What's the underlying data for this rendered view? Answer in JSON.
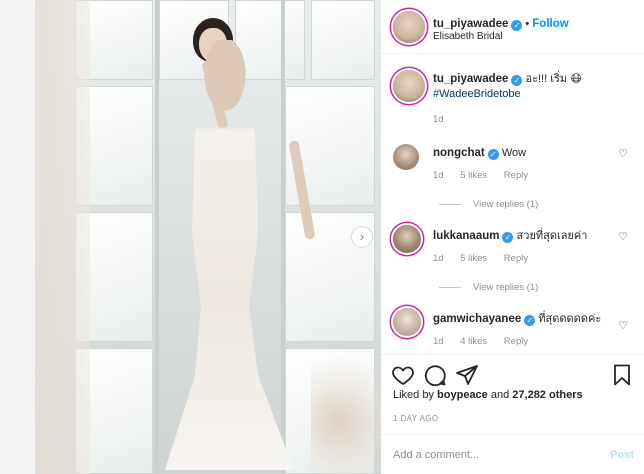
{
  "header": {
    "username": "tu_piyawadee",
    "follow_label": "Follow",
    "location": "Elisabeth Bridal",
    "dot": "•"
  },
  "caption": {
    "username": "tu_piyawadee",
    "text": "อะ!!! เริ่ม 😷",
    "hashtag": "#WadeeBridetobe",
    "age": "1d"
  },
  "comments": [
    {
      "username": "nongchat",
      "text": "Wow",
      "age": "1d",
      "likes": "5 likes",
      "reply": "Reply",
      "view_replies": "View replies (1)"
    },
    {
      "username": "lukkanaaum",
      "text": "สวยที่สุดเลยค่า",
      "age": "1d",
      "likes": "5 likes",
      "reply": "Reply",
      "view_replies": "View replies (1)"
    },
    {
      "username": "gamwichayanee",
      "text": "ที่สุดดดดดค่ะ",
      "age": "1d",
      "likes": "4 likes",
      "reply": "Reply"
    }
  ],
  "likes": {
    "prefix": "Liked by",
    "user": "boypeace",
    "middle": "and",
    "count": "27,282 others"
  },
  "timestamp": "1 DAY AGO",
  "add_comment": {
    "placeholder": "Add a comment...",
    "post_label": "Post"
  },
  "icons": {
    "verified": "verified-badge-icon",
    "heart": "heart-icon",
    "comment": "comment-icon",
    "share": "share-icon",
    "save": "bookmark-icon",
    "next": "chevron-right-icon"
  },
  "colors": {
    "accent": "#0095f6",
    "hashtag": "#00376b",
    "muted": "#8e8e8e"
  }
}
